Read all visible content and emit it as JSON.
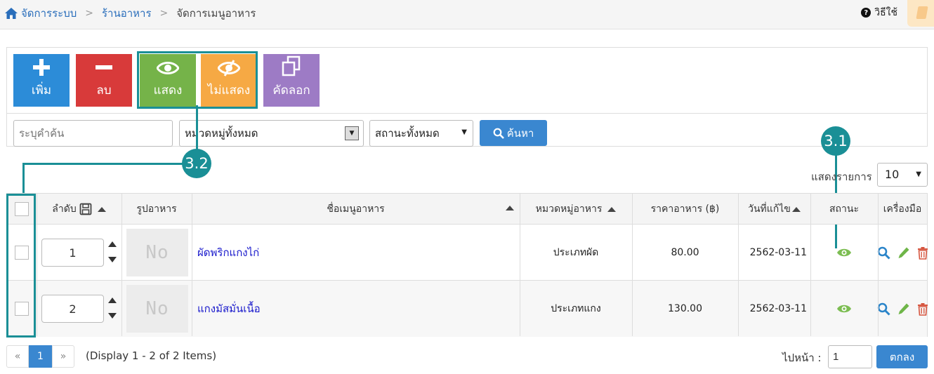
{
  "breadcrumb": {
    "items": [
      "จัดการระบบ",
      "ร้านอาหาร"
    ],
    "current": "จัดการเมนูอาหาร"
  },
  "help": {
    "label": "วิธีใช้"
  },
  "toolbar": {
    "add_label": "เพิ่ม",
    "delete_label": "ลบ",
    "show_label": "แสดง",
    "hide_label": "ไม่แสดง",
    "copy_label": "คัดลอก"
  },
  "search": {
    "placeholder": "ระบุคำค้น",
    "category_selected": "หมวดหมู่ทั้งหมด",
    "status_selected": "สถานะทั้งหมด",
    "button_label": "ค้นหา"
  },
  "annotations": {
    "status": "3.1",
    "checkbox": "3.2"
  },
  "per_page": {
    "label": "แสดงรายการ",
    "value": "10"
  },
  "table": {
    "headers": {
      "order": "ลำดับ",
      "image": "รูปอาหาร",
      "name": "ชื่อเมนูอาหาร",
      "category": "หมวดหมู่อาหาร",
      "price": "ราคาอาหาร (฿)",
      "modified": "วันที่แก้ไข",
      "status": "สถานะ",
      "tools": "เครื่องมือ"
    },
    "rows": [
      {
        "order": "1",
        "thumb": "No",
        "name": "ผัดพริกแกงไก่",
        "category": "ประเภทผัด",
        "price": "80.00",
        "modified": "2562-03-11"
      },
      {
        "order": "2",
        "thumb": "No",
        "name": "แกงมัสมั่นเนื้อ",
        "category": "ประเภทแกง",
        "price": "130.00",
        "modified": "2562-03-11"
      }
    ]
  },
  "pagination": {
    "prev": "«",
    "current": "1",
    "next": "»",
    "info": "(Display 1 - 2 of 2 Items)",
    "goto_label": "ไปหน้า :",
    "goto_value": "1",
    "goto_button": "ตกลง"
  },
  "colors": {
    "add": "#2c8cd8",
    "delete": "#d83a3a",
    "show": "#75b349",
    "hide": "#f6a944",
    "copy": "#9d7bc5",
    "primary": "#3a87d0",
    "annotation": "#1a8f96",
    "status_eye": "#7cbd52",
    "search_tool": "#2a84c9",
    "edit_tool": "#6eb548",
    "delete_tool": "#d6553f"
  }
}
